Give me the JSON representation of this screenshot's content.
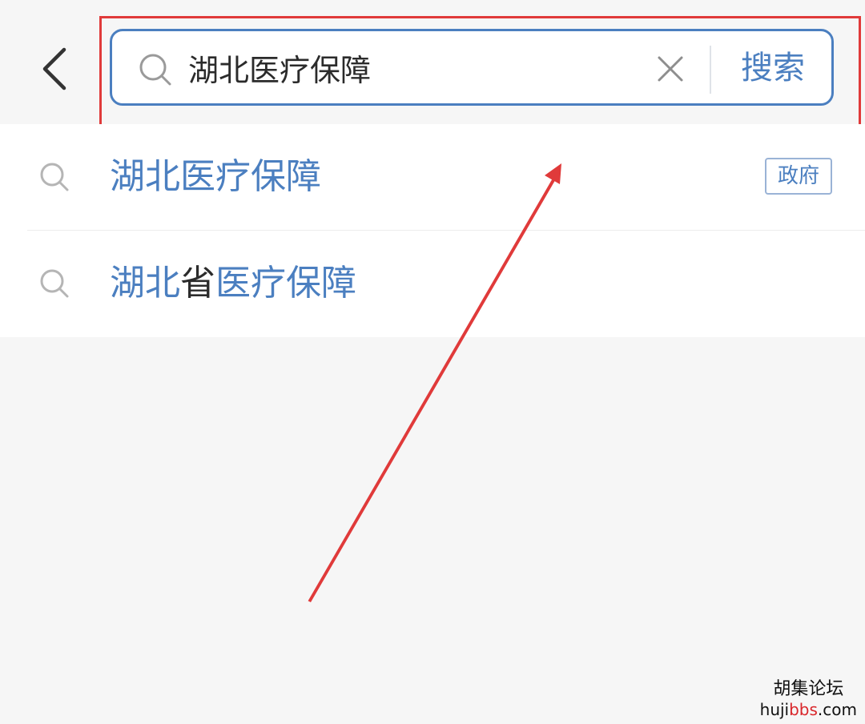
{
  "header": {
    "search": {
      "value": "湖北医疗保障",
      "button_label": "搜索"
    }
  },
  "suggestions": [
    {
      "segments": [
        {
          "text": "湖北医疗保障",
          "highlight": true
        }
      ],
      "tag": "政府"
    },
    {
      "segments": [
        {
          "text": "湖北",
          "highlight": true
        },
        {
          "text": "省",
          "highlight": false
        },
        {
          "text": "医疗保障",
          "highlight": true
        }
      ]
    }
  ],
  "watermark": {
    "title": "胡集论坛",
    "url_prefix": "huji",
    "url_highlight": "bbs",
    "url_suffix": ".com"
  },
  "colors": {
    "accent": "#4b7fc0",
    "annotation": "#e03a3a",
    "text": "#2b2b2b",
    "background": "#f6f6f6"
  }
}
